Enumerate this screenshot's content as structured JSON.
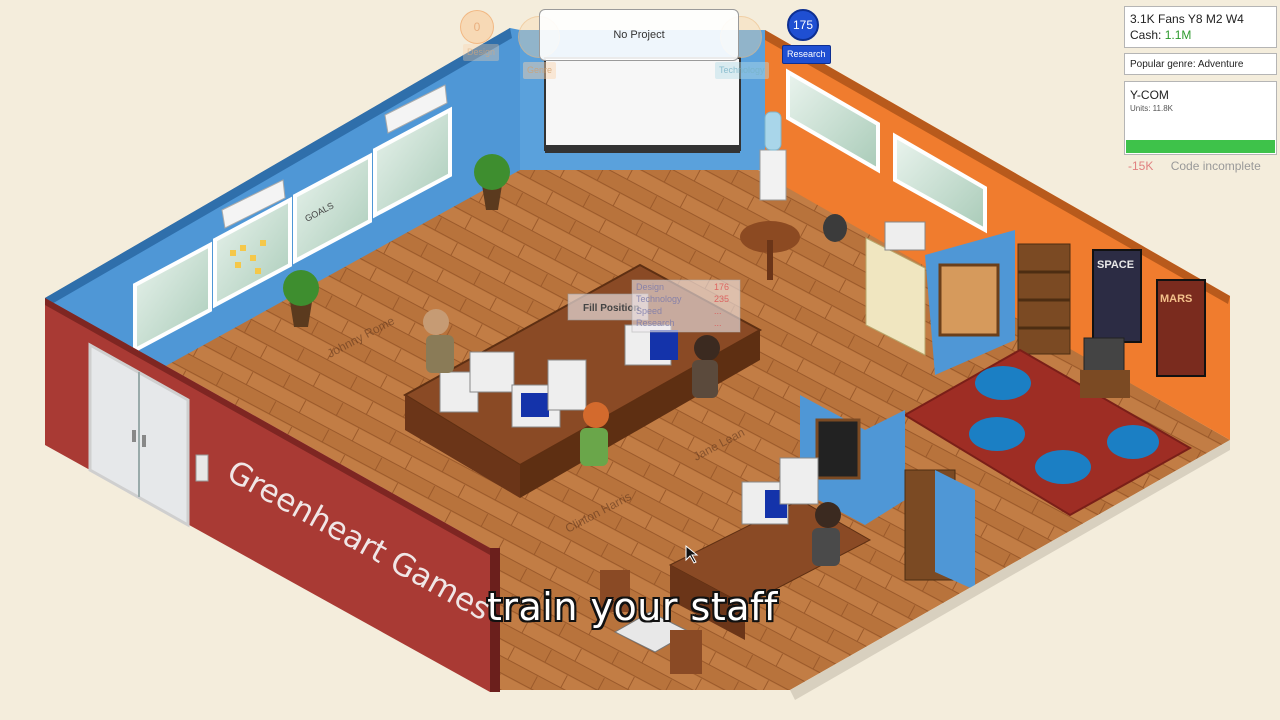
{
  "hud": {
    "design_points": "0",
    "design_label": "Design",
    "genre_label": "Genre",
    "technology_label": "Technology",
    "project_label": "No Project",
    "research_points": "175",
    "research_label": "Research"
  },
  "stats": {
    "fans_line": "3.1K Fans Y8 M2 W4",
    "cash_label": "Cash:",
    "cash_value": "1.1M",
    "popular_genre": "Popular genre: Adventure"
  },
  "current_game": {
    "title": "Y-COM",
    "units": "Units: 11.8K",
    "progress": 1.0,
    "profit": "-15K",
    "status": "Code incomplete"
  },
  "office": {
    "company_sign": "Greenheart Games",
    "staff": [
      "Johnny Rome",
      "Clinton Harris",
      "Jane Lean"
    ],
    "context_menu": {
      "fill_position": "Fill Position",
      "rows": [
        {
          "label": "Design",
          "value": "176"
        },
        {
          "label": "Technology",
          "value": "235"
        },
        {
          "label": "Speed",
          "value": "..."
        },
        {
          "label": "Research",
          "value": "..."
        }
      ]
    },
    "whiteboard_text": "GOALS",
    "poster_space": "SPACE",
    "poster_mars": "MARS"
  },
  "subtitle": "train your staff",
  "colors": {
    "floor": "#b8733c",
    "wall_blue": "#4f97d6",
    "wall_orange": "#f07c2e",
    "wall_red": "#a93a34",
    "cash_green": "#2d9a2d",
    "research_blue": "#1f4fd2",
    "progress_green": "#3ec24a"
  }
}
